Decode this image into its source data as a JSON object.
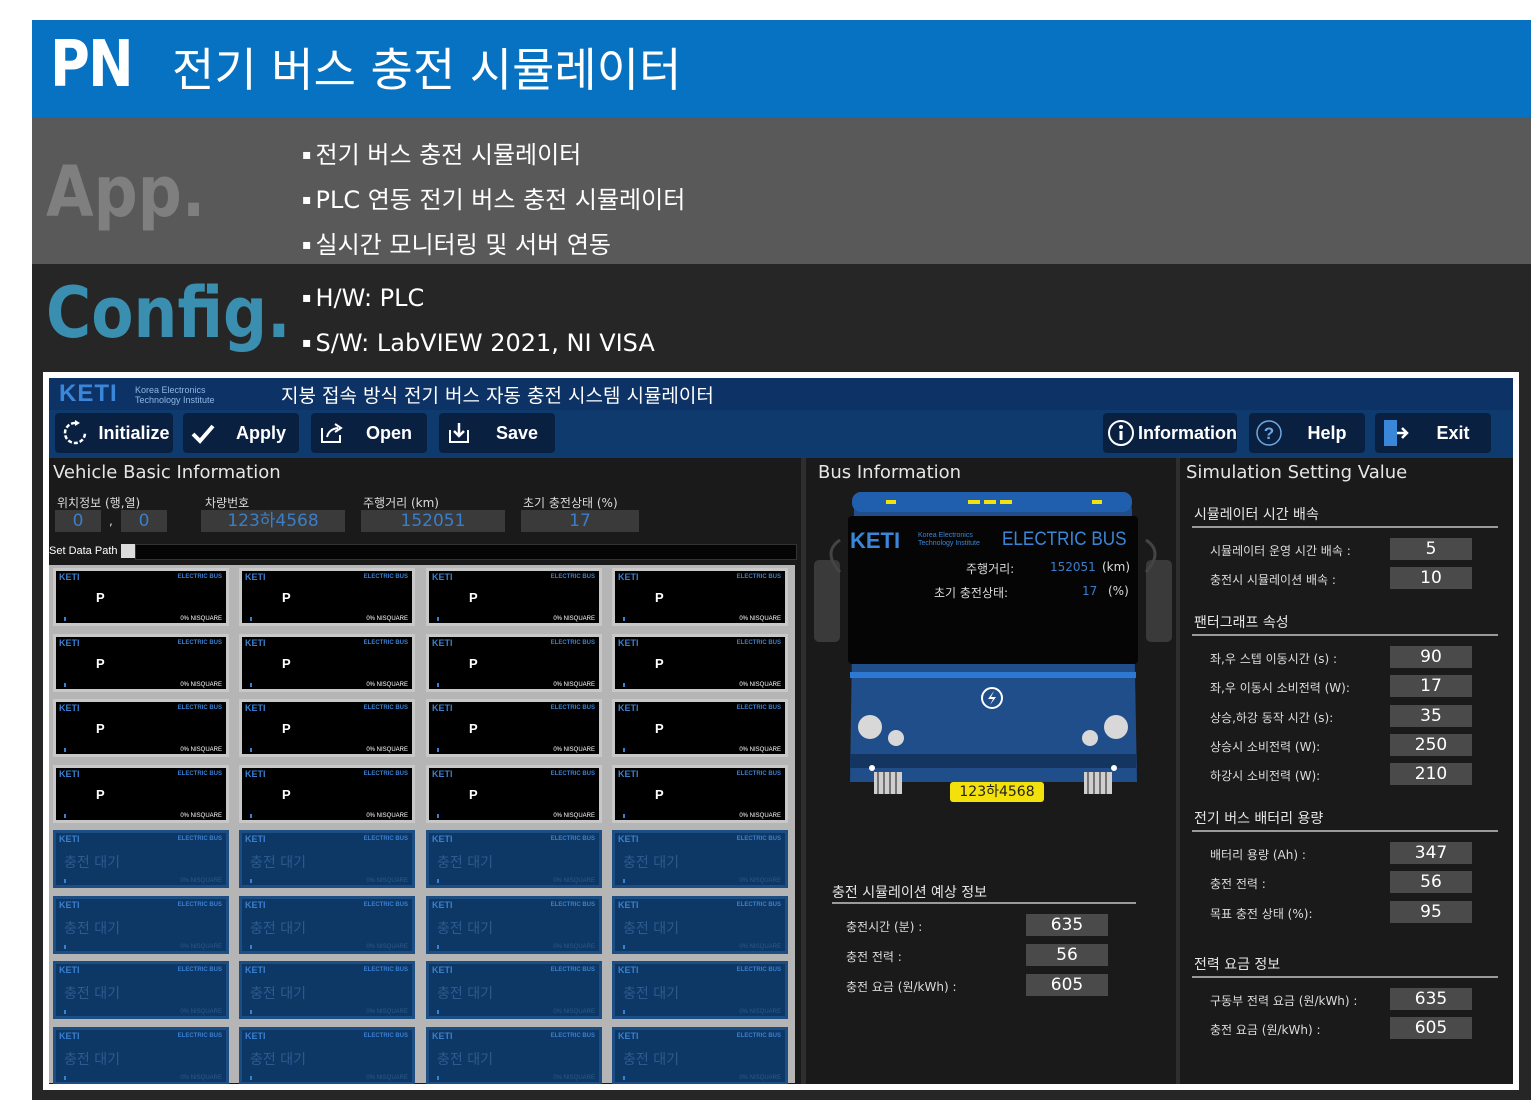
{
  "slide": {
    "badge": "PN",
    "title": "전기 버스 충전 시뮬레이터",
    "app_label": "App.",
    "app_bullets": [
      "전기 버스 충전 시뮬레이터",
      "PLC 연동 전기 버스 충전 시뮬레이터",
      "실시간 모니터링 및 서버 연동"
    ],
    "config_label": "Config.",
    "config_bullets": [
      "H/W: PLC",
      "S/W: LabVIEW 2021, NI VISA"
    ]
  },
  "app": {
    "logo_text": "KETI",
    "logo_sub1": "Korea Electronics",
    "logo_sub2": "Technology Institute",
    "title": "지붕 접속 방식 전기 버스 자동 충전 시스템 시뮬레이터",
    "toolbar": {
      "initialize": "Initialize",
      "apply": "Apply",
      "open": "Open",
      "save": "Save",
      "information": "Information",
      "help": "Help",
      "exit": "Exit"
    },
    "vehicle": {
      "title": "Vehicle Basic Information",
      "pos_label": "위치정보 (행,열)",
      "pos_row": "0",
      "pos_sep": ",",
      "pos_col": "0",
      "car_label": "차량번호",
      "car_number": "123하4568",
      "dist_label": "주행거리 (km)",
      "distance": "152051",
      "soc_label": "초기 충전상태 (%)",
      "soc": "17",
      "path_label": "Set Data Path"
    },
    "grid": {
      "cell_logo": "KETI",
      "cell_brand": "ELECTRIC BUS",
      "parked_text": "P",
      "waiting_text": "충전 대기",
      "pct_text": "0%  NISQUARE",
      "parked_rows": 4,
      "waiting_rows": 4,
      "cols": 4
    },
    "bus": {
      "title": "Bus Information",
      "brand": "ELECTRIC BUS",
      "dist_label": "주행거리:",
      "dist_value": "152051",
      "dist_unit": "(km)",
      "soc_label": "초기 충전상태:",
      "soc_value": "17",
      "soc_unit": "(%)",
      "plate": "123하4568",
      "forecast_title": "충전 시뮬레이션 예상 정보",
      "forecast": [
        {
          "label": "충전시간 (분) :",
          "value": "635"
        },
        {
          "label": "충전 전력 :",
          "value": "56"
        },
        {
          "label": "충전 요금 (원/kWh) :",
          "value": "605"
        }
      ]
    },
    "settings": {
      "title": "Simulation Setting  Value",
      "groups": [
        {
          "title": "시뮬레이터 시간 배속",
          "rows": [
            {
              "label": "시뮬레이터 운영 시간 배속 :",
              "value": "5"
            },
            {
              "label": "충전시 시뮬레이션 배속 :",
              "value": "10"
            }
          ]
        },
        {
          "title": "팬터그래프 속성",
          "rows": [
            {
              "label": "좌,우 스텝 이동시간 (s) :",
              "value": "90"
            },
            {
              "label": "좌,우 이동시 소비전력 (W):",
              "value": "17"
            },
            {
              "label": "상승,하강 동작 시간 (s):",
              "value": "35"
            },
            {
              "label": "상승시 소비전력 (W):",
              "value": "250"
            },
            {
              "label": "하강시 소비전력 (W):",
              "value": "210"
            }
          ]
        },
        {
          "title": "전기 버스 배터리 용량",
          "rows": [
            {
              "label": "배터리 용량 (Ah) :",
              "value": "347"
            },
            {
              "label": "충전 전력 :",
              "value": "56"
            },
            {
              "label": "목표 충전 상태 (%):",
              "value": "95"
            }
          ]
        },
        {
          "title": "전력 요금 정보",
          "rows": [
            {
              "label": "구동부 전력 요금 (원/kWh) :",
              "value": "635"
            },
            {
              "label": "충전 요금 (원/kWh) :",
              "value": "605"
            }
          ]
        }
      ]
    }
  },
  "colors": {
    "header_blue": "#0772c1",
    "app_band": "#595959",
    "config_band": "#262626",
    "config_label": "#3a8eb0",
    "value_blue": "#3b7ec8",
    "toolbar": "#0e3a6e",
    "plate_yellow": "#f2e10a",
    "bus_blue": "#1f4e8a"
  }
}
